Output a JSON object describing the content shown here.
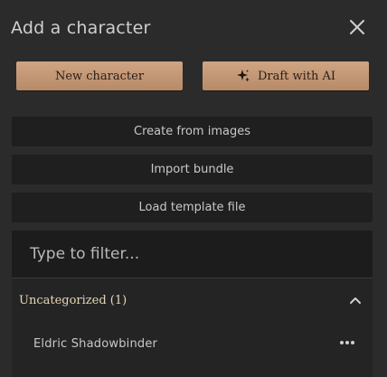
{
  "dialog": {
    "title": "Add a character",
    "close_icon": "close-icon"
  },
  "actions": {
    "new_character": "New character",
    "draft_with_ai": "Draft with AI",
    "create_from_images": "Create from images",
    "import_bundle": "Import bundle",
    "load_template_file": "Load template file"
  },
  "filter": {
    "placeholder": "Type to filter...",
    "value": ""
  },
  "groups": [
    {
      "label": "Uncategorized (1)",
      "expanded": true,
      "items": [
        {
          "label": "Eldric Shadowbinder",
          "menu_icon": "more-icon"
        }
      ]
    }
  ],
  "colors": {
    "accent": "#c49a78",
    "background": "#2b2b2b",
    "group_label": "#e6d7b4"
  }
}
